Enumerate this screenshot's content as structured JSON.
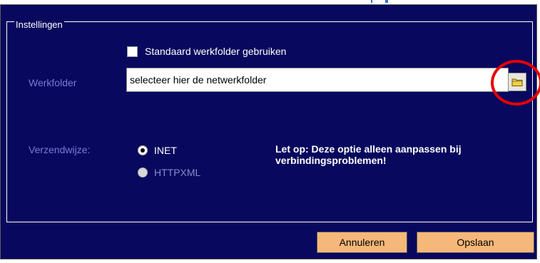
{
  "groupbox": {
    "title": "Instellingen"
  },
  "checkbox": {
    "label": "Standaard werkfolder gebruiken",
    "checked": false
  },
  "werkfolder": {
    "label": "Werkfolder",
    "value": "selecteer hier de netwerkfolder",
    "browse_icon": "folder-icon"
  },
  "verzendwijze": {
    "label": "Verzendwijze:",
    "options": [
      {
        "label": "INET",
        "selected": true,
        "enabled": true
      },
      {
        "label": "HTTPXML",
        "selected": false,
        "enabled": false
      }
    ]
  },
  "warning": "Let op: Deze optie alleen aanpassen bij verbindingsproblemen!",
  "buttons": {
    "cancel": "Annuleren",
    "save": "Opslaan"
  },
  "colors": {
    "dialog_background": "#08085e",
    "button_background": "#f5b87a",
    "highlight_ring": "#e50000"
  }
}
